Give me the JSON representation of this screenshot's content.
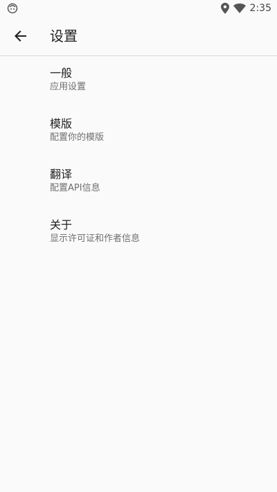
{
  "status_bar": {
    "left_icon": "app-notification-icon",
    "right_icons": [
      "location-icon",
      "wifi-icon"
    ],
    "time": "2:35"
  },
  "app_bar": {
    "back_icon": "arrow-back-icon",
    "title": "设置"
  },
  "settings": {
    "items": [
      {
        "title": "一般",
        "subtitle": "应用设置"
      },
      {
        "title": "模版",
        "subtitle": "配置你的模版"
      },
      {
        "title": "翻译",
        "subtitle": "配置API信息"
      },
      {
        "title": "关于",
        "subtitle": "显示许可证和作者信息"
      }
    ]
  }
}
